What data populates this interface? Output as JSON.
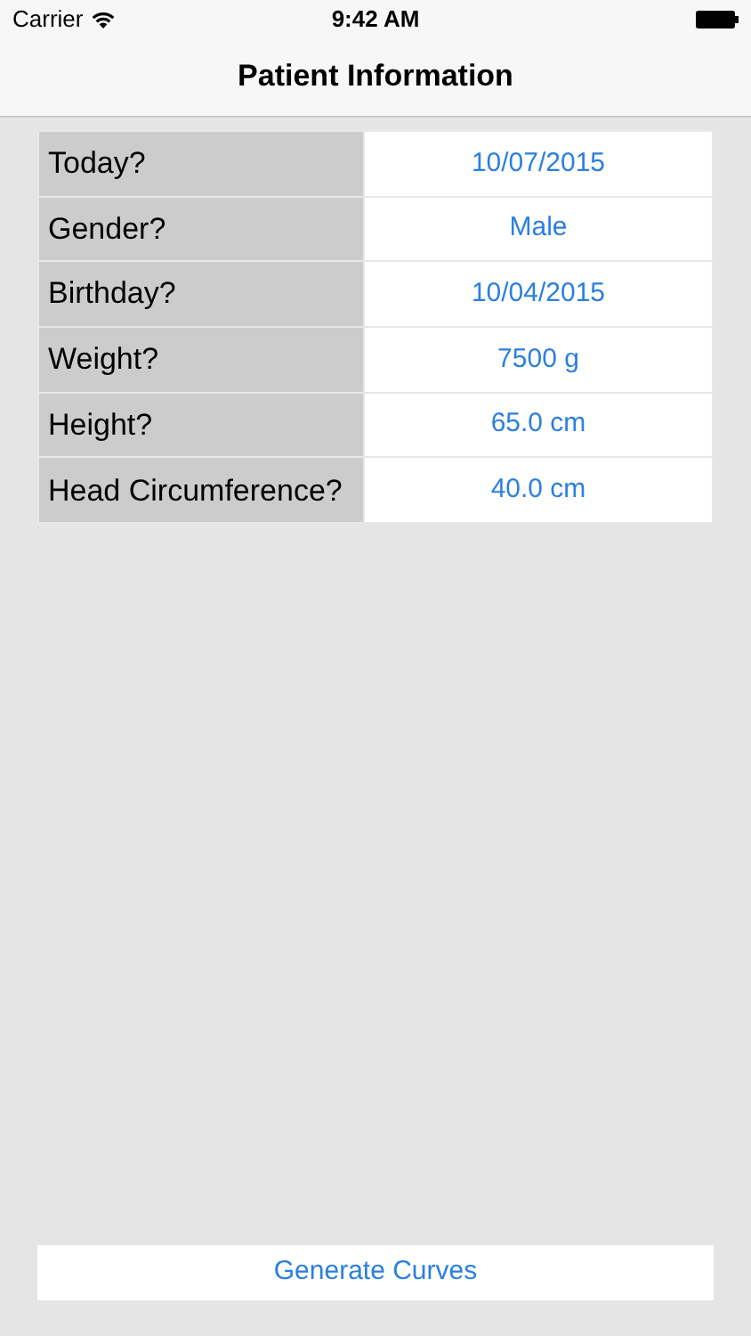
{
  "status_bar": {
    "carrier": "Carrier",
    "time": "9:42 AM"
  },
  "nav_bar": {
    "title": "Patient Information"
  },
  "fields": [
    {
      "label": "Today?",
      "value": "10/07/2015"
    },
    {
      "label": "Gender?",
      "value": "Male"
    },
    {
      "label": "Birthday?",
      "value": "10/04/2015"
    },
    {
      "label": "Weight?",
      "value": "7500 g"
    },
    {
      "label": "Height?",
      "value": "65.0 cm"
    },
    {
      "label": "Head Circumference?",
      "value": "40.0 cm"
    }
  ],
  "buttons": [
    "Generate Curves"
  ]
}
